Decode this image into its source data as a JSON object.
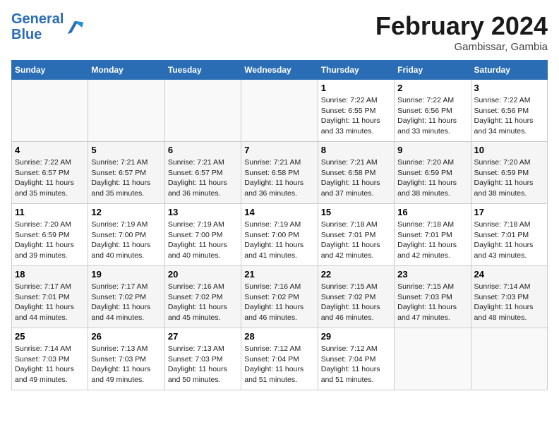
{
  "header": {
    "logo_line1": "General",
    "logo_line2": "Blue",
    "month_title": "February 2024",
    "location": "Gambissar, Gambia"
  },
  "weekdays": [
    "Sunday",
    "Monday",
    "Tuesday",
    "Wednesday",
    "Thursday",
    "Friday",
    "Saturday"
  ],
  "weeks": [
    [
      {
        "day": "",
        "info": ""
      },
      {
        "day": "",
        "info": ""
      },
      {
        "day": "",
        "info": ""
      },
      {
        "day": "",
        "info": ""
      },
      {
        "day": "1",
        "info": "Sunrise: 7:22 AM\nSunset: 6:55 PM\nDaylight: 11 hours and 33 minutes."
      },
      {
        "day": "2",
        "info": "Sunrise: 7:22 AM\nSunset: 6:56 PM\nDaylight: 11 hours and 33 minutes."
      },
      {
        "day": "3",
        "info": "Sunrise: 7:22 AM\nSunset: 6:56 PM\nDaylight: 11 hours and 34 minutes."
      }
    ],
    [
      {
        "day": "4",
        "info": "Sunrise: 7:22 AM\nSunset: 6:57 PM\nDaylight: 11 hours and 35 minutes."
      },
      {
        "day": "5",
        "info": "Sunrise: 7:21 AM\nSunset: 6:57 PM\nDaylight: 11 hours and 35 minutes."
      },
      {
        "day": "6",
        "info": "Sunrise: 7:21 AM\nSunset: 6:57 PM\nDaylight: 11 hours and 36 minutes."
      },
      {
        "day": "7",
        "info": "Sunrise: 7:21 AM\nSunset: 6:58 PM\nDaylight: 11 hours and 36 minutes."
      },
      {
        "day": "8",
        "info": "Sunrise: 7:21 AM\nSunset: 6:58 PM\nDaylight: 11 hours and 37 minutes."
      },
      {
        "day": "9",
        "info": "Sunrise: 7:20 AM\nSunset: 6:59 PM\nDaylight: 11 hours and 38 minutes."
      },
      {
        "day": "10",
        "info": "Sunrise: 7:20 AM\nSunset: 6:59 PM\nDaylight: 11 hours and 38 minutes."
      }
    ],
    [
      {
        "day": "11",
        "info": "Sunrise: 7:20 AM\nSunset: 6:59 PM\nDaylight: 11 hours and 39 minutes."
      },
      {
        "day": "12",
        "info": "Sunrise: 7:19 AM\nSunset: 7:00 PM\nDaylight: 11 hours and 40 minutes."
      },
      {
        "day": "13",
        "info": "Sunrise: 7:19 AM\nSunset: 7:00 PM\nDaylight: 11 hours and 40 minutes."
      },
      {
        "day": "14",
        "info": "Sunrise: 7:19 AM\nSunset: 7:00 PM\nDaylight: 11 hours and 41 minutes."
      },
      {
        "day": "15",
        "info": "Sunrise: 7:18 AM\nSunset: 7:01 PM\nDaylight: 11 hours and 42 minutes."
      },
      {
        "day": "16",
        "info": "Sunrise: 7:18 AM\nSunset: 7:01 PM\nDaylight: 11 hours and 42 minutes."
      },
      {
        "day": "17",
        "info": "Sunrise: 7:18 AM\nSunset: 7:01 PM\nDaylight: 11 hours and 43 minutes."
      }
    ],
    [
      {
        "day": "18",
        "info": "Sunrise: 7:17 AM\nSunset: 7:01 PM\nDaylight: 11 hours and 44 minutes."
      },
      {
        "day": "19",
        "info": "Sunrise: 7:17 AM\nSunset: 7:02 PM\nDaylight: 11 hours and 44 minutes."
      },
      {
        "day": "20",
        "info": "Sunrise: 7:16 AM\nSunset: 7:02 PM\nDaylight: 11 hours and 45 minutes."
      },
      {
        "day": "21",
        "info": "Sunrise: 7:16 AM\nSunset: 7:02 PM\nDaylight: 11 hours and 46 minutes."
      },
      {
        "day": "22",
        "info": "Sunrise: 7:15 AM\nSunset: 7:02 PM\nDaylight: 11 hours and 46 minutes."
      },
      {
        "day": "23",
        "info": "Sunrise: 7:15 AM\nSunset: 7:03 PM\nDaylight: 11 hours and 47 minutes."
      },
      {
        "day": "24",
        "info": "Sunrise: 7:14 AM\nSunset: 7:03 PM\nDaylight: 11 hours and 48 minutes."
      }
    ],
    [
      {
        "day": "25",
        "info": "Sunrise: 7:14 AM\nSunset: 7:03 PM\nDaylight: 11 hours and 49 minutes."
      },
      {
        "day": "26",
        "info": "Sunrise: 7:13 AM\nSunset: 7:03 PM\nDaylight: 11 hours and 49 minutes."
      },
      {
        "day": "27",
        "info": "Sunrise: 7:13 AM\nSunset: 7:03 PM\nDaylight: 11 hours and 50 minutes."
      },
      {
        "day": "28",
        "info": "Sunrise: 7:12 AM\nSunset: 7:04 PM\nDaylight: 11 hours and 51 minutes."
      },
      {
        "day": "29",
        "info": "Sunrise: 7:12 AM\nSunset: 7:04 PM\nDaylight: 11 hours and 51 minutes."
      },
      {
        "day": "",
        "info": ""
      },
      {
        "day": "",
        "info": ""
      }
    ]
  ]
}
